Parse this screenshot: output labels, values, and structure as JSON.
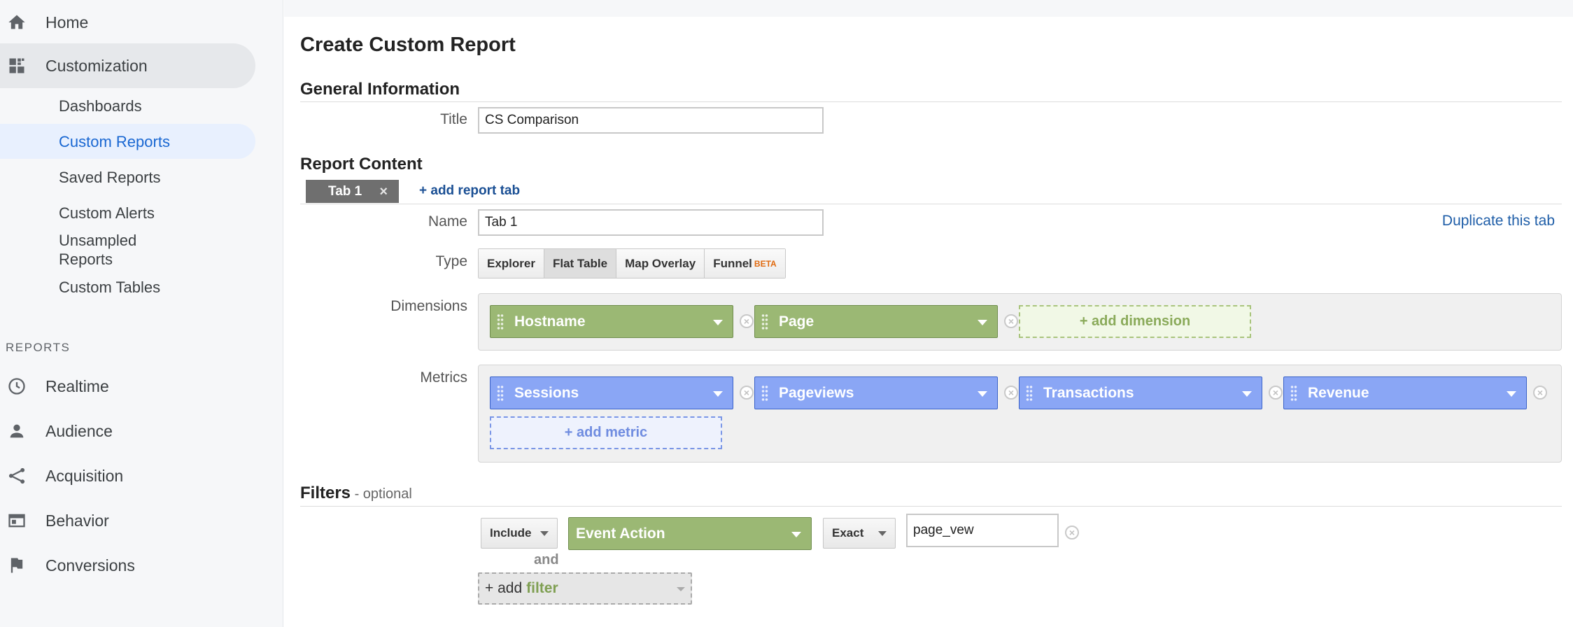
{
  "sidebar": {
    "home": {
      "label": "Home",
      "icon": "home-icon"
    },
    "customization": {
      "label": "Customization",
      "icon": "dashboard-icon"
    },
    "sub_items": [
      "Dashboards",
      "Custom Reports",
      "Saved Reports",
      "Custom Alerts",
      "Unsampled",
      "Reports",
      "Custom Tables"
    ],
    "section_label": "REPORTS",
    "reports": [
      {
        "label": "Realtime",
        "icon": "clock-icon"
      },
      {
        "label": "Audience",
        "icon": "person-icon"
      },
      {
        "label": "Acquisition",
        "icon": "acquisition-icon"
      },
      {
        "label": "Behavior",
        "icon": "behavior-icon"
      },
      {
        "label": "Conversions",
        "icon": "flag-icon"
      }
    ],
    "active_sub": "Custom Reports"
  },
  "page": {
    "title": "Create Custom Report",
    "general_heading": "General Information",
    "title_label": "Title",
    "title_value": "CS Comparison",
    "content_heading": "Report Content",
    "tab_label": "Tab 1",
    "tab_close": "×",
    "add_tab": "+ add report tab",
    "name_label": "Name",
    "name_value": "Tab 1",
    "duplicate": "Duplicate this tab",
    "type_label": "Type",
    "types": [
      "Explorer",
      "Flat Table",
      "Map Overlay",
      "Funnel"
    ],
    "beta": "BETA",
    "active_type": "Flat Table",
    "dimensions_label": "Dimensions",
    "dimensions": [
      "Hostname",
      "Page"
    ],
    "add_dimension": "+ add dimension",
    "metrics_label": "Metrics",
    "metrics": [
      "Sessions",
      "Pageviews",
      "Transactions",
      "Revenue"
    ],
    "add_metric": "+ add metric",
    "filters_heading": "Filters",
    "filters_optional": " - optional",
    "filter": {
      "include": "Include",
      "dimension": "Event Action",
      "match": "Exact",
      "value": "page_vew"
    },
    "and_label": "and",
    "add_filter_prefix": "+ add",
    "add_filter_word": "filter"
  }
}
